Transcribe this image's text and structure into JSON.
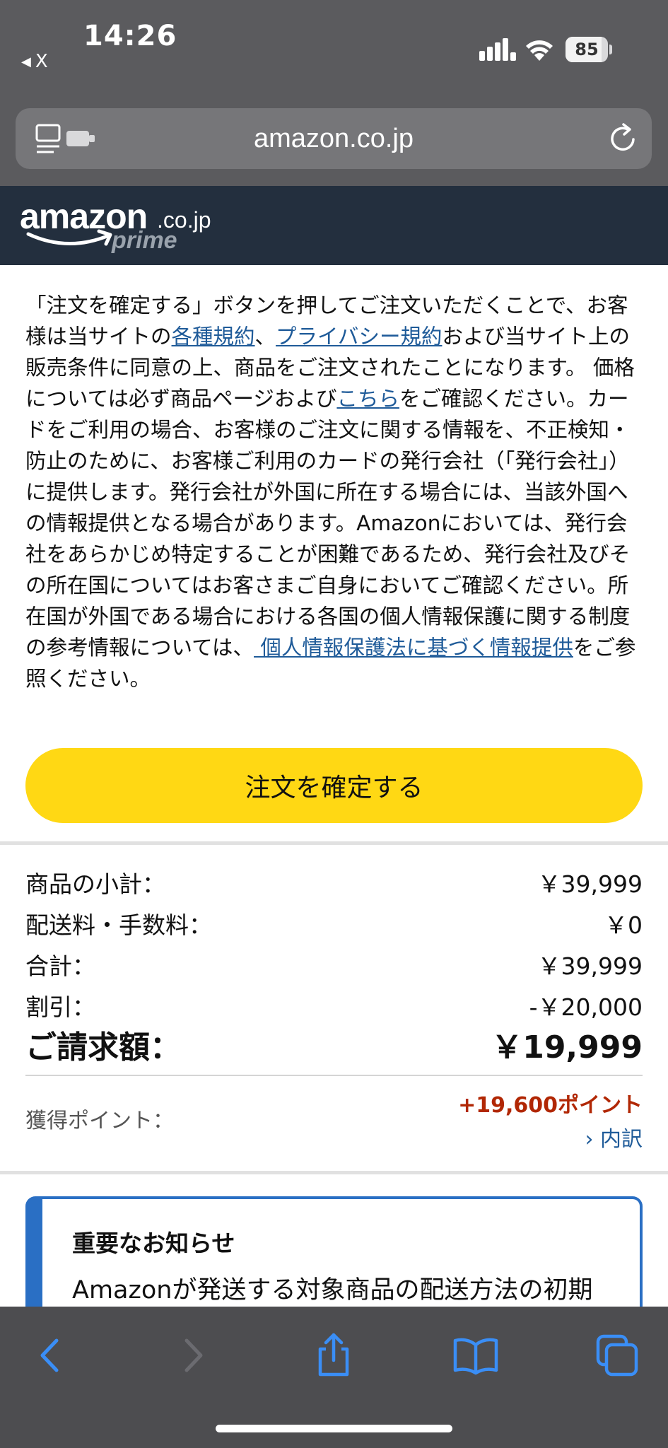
{
  "status_bar": {
    "time": "14:26",
    "back_app": "X",
    "battery": "85",
    "battery_level": 0.85
  },
  "browser": {
    "url": "amazon.co.jp"
  },
  "header": {
    "logo_main": "amazon",
    "logo_suffix": ".co.jp",
    "logo_sub": "prime"
  },
  "legal": {
    "p1": "「注文を確定する」ボタンを押してご注文いただくことで、お客様は当サイトの",
    "link_terms": "各種規約",
    "p2": "、",
    "link_privacy": "プライバシー規約",
    "p3": "および当サイト上の販売条件に同意の上、商品をご注文されたことになります。 価格については必ず商品ページおよび",
    "link_here": "こちら",
    "p4": "をご確認ください。カードをご利用の場合、お客様のご注文に関する情報を、不正検知・防止のために、お客様ご利用のカードの発行会社（「発行会社」）に提供します。発行会社が外国に所在する場合には、当該外国への情報提供となる場合があります。Amazonにおいては、発行会社をあらかじめ特定することが困難であるため、発行会社及びその所在国についてはお客さまご自身においてご確認ください。所在国が外国である場合における各国の個人情報保護に関する制度の参考情報については、",
    "link_info": " 個人情報保護法に基づく情報提供",
    "p5": "をご参照ください。"
  },
  "confirm_button": "注文を確定する",
  "summary": {
    "subtotal_label": "商品の小計：",
    "subtotal_value": "￥39,999",
    "shipping_label": "配送料・手数料：",
    "shipping_value": "￥0",
    "total_label": "合計：",
    "total_value": "￥39,999",
    "discount_label": "割引：",
    "discount_value": "-￥20,000",
    "billing_label": "ご請求額：",
    "billing_value": "￥19,999",
    "points_label": "獲得ポイント：",
    "points_value": "+19,600ポイント",
    "points_link": "› 内訳"
  },
  "notice": {
    "title": "重要なお知らせ",
    "body": "Amazonが発送する対象商品の配送方法の初期"
  },
  "colors": {
    "button": "#ffd814",
    "header": "#232f3e",
    "link": "#1f5b99",
    "points": "#b12704",
    "notice_border": "#2a6fc4"
  },
  "icons": {
    "reader": "reader-mode-icon",
    "reload": "reload-icon",
    "back": "chevron-left-icon",
    "forward": "chevron-right-icon",
    "share": "share-icon",
    "bookmarks": "book-icon",
    "tabs": "tabs-icon"
  }
}
